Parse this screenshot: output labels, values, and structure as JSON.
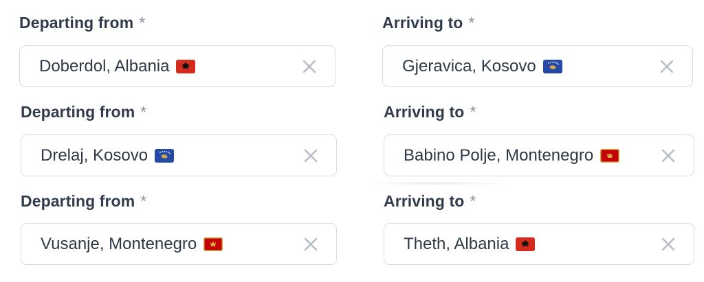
{
  "rows": [
    {
      "from": {
        "label": "Departing from",
        "required": "*",
        "value": "Doberdol, Albania",
        "flag": "albania-flag-icon"
      },
      "to": {
        "label": "Arriving to",
        "required": "*",
        "value": "Gjeravica, Kosovo",
        "flag": "kosovo-flag-icon"
      }
    },
    {
      "from": {
        "label": "Departing from",
        "required": "*",
        "value": "Drelaj, Kosovo",
        "flag": "kosovo-flag-icon"
      },
      "to": {
        "label": "Arriving to",
        "required": "*",
        "value": "Babino Polje, Montenegro",
        "flag": "montenegro-flag-icon"
      }
    },
    {
      "from": {
        "label": "Departing from",
        "required": "*",
        "value": "Vusanje, Montenegro",
        "flag": "montenegro-flag-icon"
      },
      "to": {
        "label": "Arriving to",
        "required": "*",
        "value": "Theth, Albania",
        "flag": "albania-flag-icon"
      }
    }
  ],
  "icons": {
    "clear": "close-icon"
  },
  "colors": {
    "albania": "#d52b1e",
    "kosovo": "#244aa5",
    "montenegro": "#c40308",
    "border": "#d6dbe2",
    "clear_icon": "#b6bcc5"
  }
}
